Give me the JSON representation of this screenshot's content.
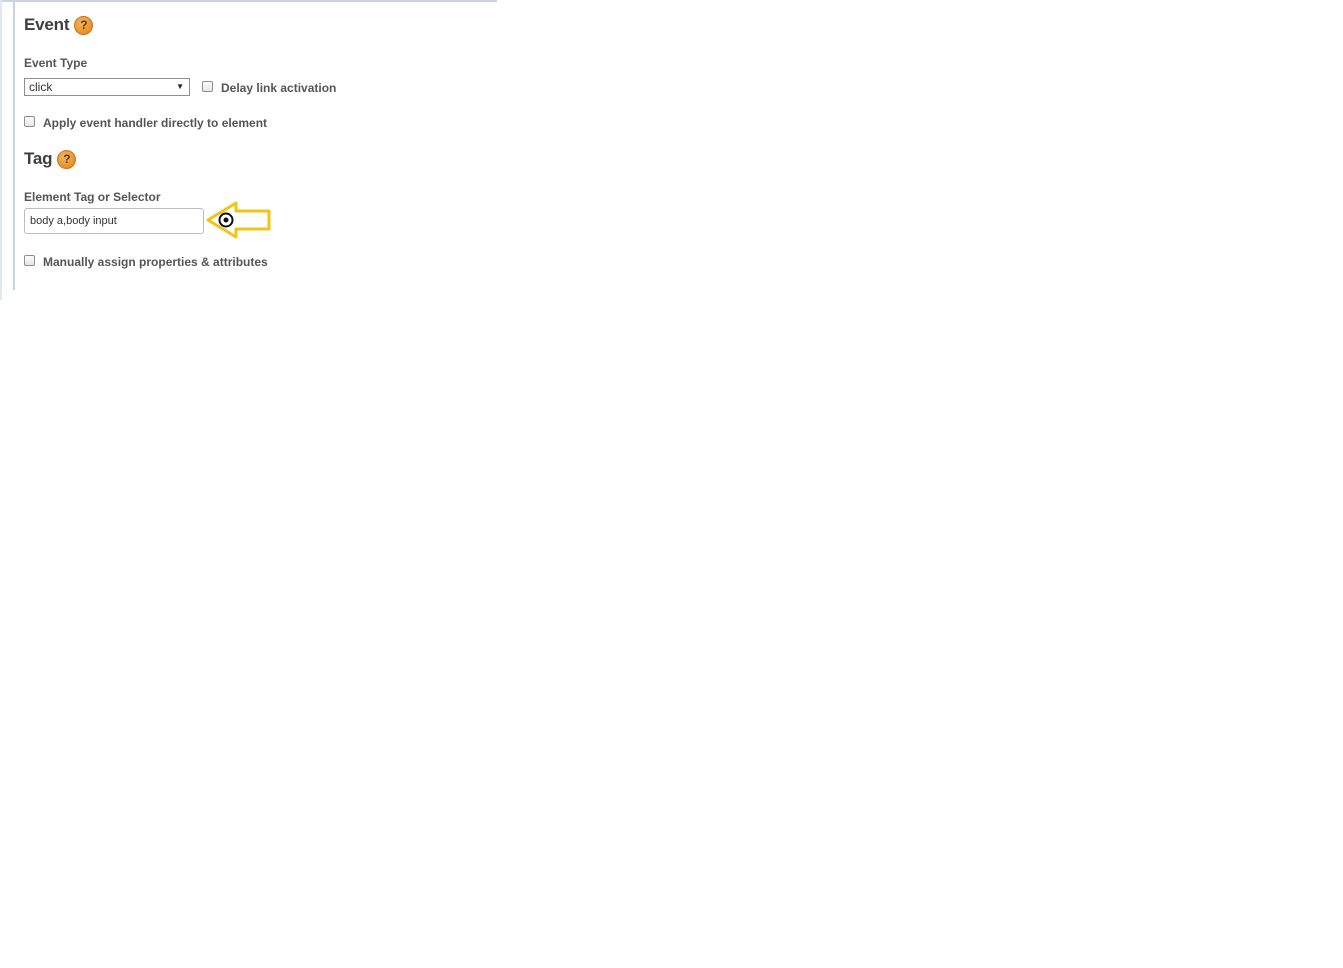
{
  "event_section": {
    "title": "Event",
    "help_glyph": "?",
    "event_type_label": "Event Type",
    "event_type_value": "click",
    "delay_link_label": "Delay link activation",
    "delay_link_checked": false,
    "apply_handler_label": "Apply event handler directly to element",
    "apply_handler_checked": false
  },
  "tag_section": {
    "title": "Tag",
    "help_glyph": "?",
    "selector_label": "Element Tag or Selector",
    "selector_value": "body a,body input",
    "manual_assign_label": "Manually assign properties & attributes",
    "manual_assign_checked": false
  },
  "colors": {
    "help_icon": "#e8912a",
    "annotation_arrow": "#f2c417",
    "frame_border": "#c9d4e2"
  },
  "icons": {
    "help": "help-icon",
    "select_arrow": "triangle-down-icon",
    "annotation": "arrow-left-annotation-icon",
    "cursor": "target-cursor-icon"
  }
}
